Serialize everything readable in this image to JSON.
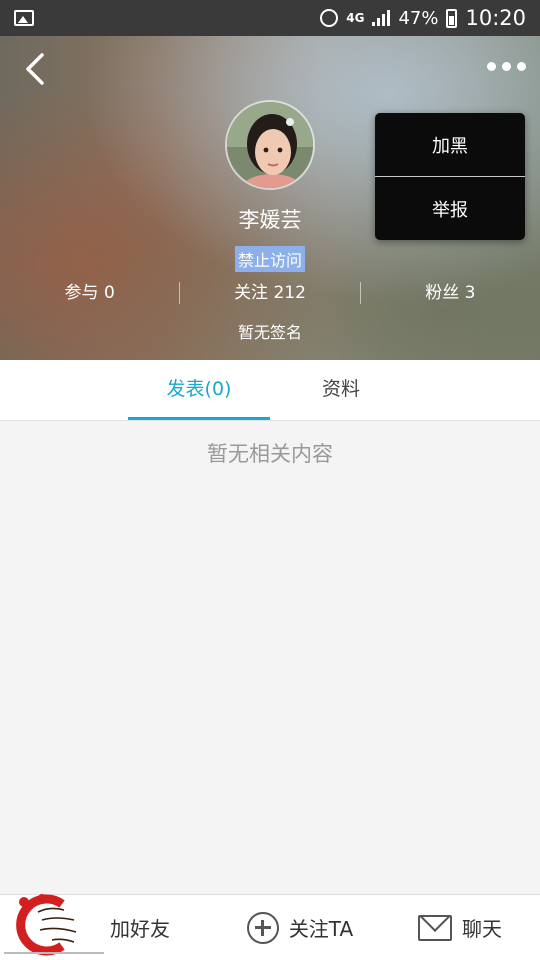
{
  "status_bar": {
    "network": "4G",
    "battery": "47%",
    "time": "10:20"
  },
  "header": {
    "username": "李媛芸",
    "banned_badge": "禁止访问",
    "stats": [
      {
        "label": "参与 0"
      },
      {
        "label": "关注 212"
      },
      {
        "label": "粉丝 3"
      }
    ],
    "signature": "暂无签名"
  },
  "popup_menu": {
    "items": [
      {
        "label": "加黑"
      },
      {
        "label": "举报"
      }
    ]
  },
  "tabs": [
    {
      "label": "发表(0)",
      "active": true
    },
    {
      "label": "资料",
      "active": false
    }
  ],
  "content": {
    "empty_text": "暂无相关内容"
  },
  "bottom_bar": {
    "add_friend": "加好友",
    "follow": "关注TA",
    "chat": "聊天"
  },
  "colors": {
    "accent": "#1ba8c9",
    "badge": "#8eb0ea",
    "popup_bg": "#0b0b0b"
  }
}
